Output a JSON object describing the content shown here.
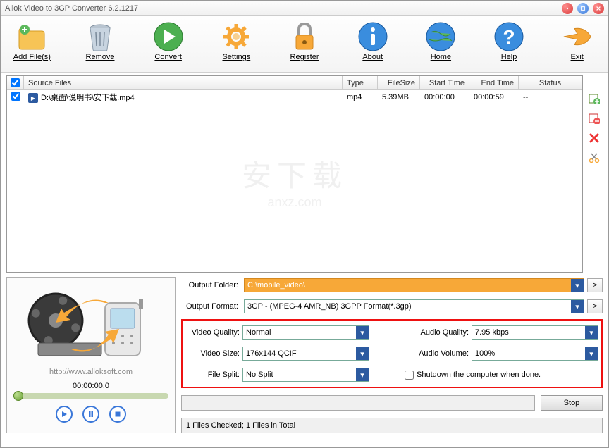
{
  "title": "Allok Video to 3GP Converter 6.2.1217",
  "toolbar": {
    "addfiles": "Add File(s)",
    "remove": "Remove",
    "convert": "Convert",
    "settings": "Settings",
    "register": "Register",
    "about": "About",
    "home": "Home",
    "help": "Help",
    "exit": "Exit"
  },
  "columns": {
    "source": "Source Files",
    "type": "Type",
    "size": "FileSize",
    "start": "Start Time",
    "end": "End Time",
    "status": "Status"
  },
  "files": [
    {
      "path": "D:\\桌面\\说明书\\安下载.mp4",
      "type": "mp4",
      "size": "5.39MB",
      "start": "00:00:00",
      "end": "00:00:59",
      "status": "--",
      "checked": true
    }
  ],
  "watermark": {
    "logo": "安下载",
    "url": "anxz.com"
  },
  "preview": {
    "url": "http://www.alloksoft.com",
    "time": "00:00:00.0"
  },
  "output": {
    "folder_label": "Output Folder:",
    "folder": "C:\\mobile_video\\",
    "format_label": "Output Format:",
    "format": "3GP - (MPEG-4 AMR_NB) 3GPP Format(*.3gp)"
  },
  "settings": {
    "vq_label": "Video Quality:",
    "vq": "Normal",
    "aq_label": "Audio Quality:",
    "aq": "7.95  kbps",
    "vs_label": "Video Size:",
    "vs": "176x144   QCIF",
    "av_label": "Audio Volume:",
    "av": "100%",
    "fs_label": "File Split:",
    "fs": "No Split",
    "shutdown": "Shutdown the computer when done."
  },
  "stop": "Stop",
  "statusbar": "1 Files Checked; 1 Files in Total"
}
